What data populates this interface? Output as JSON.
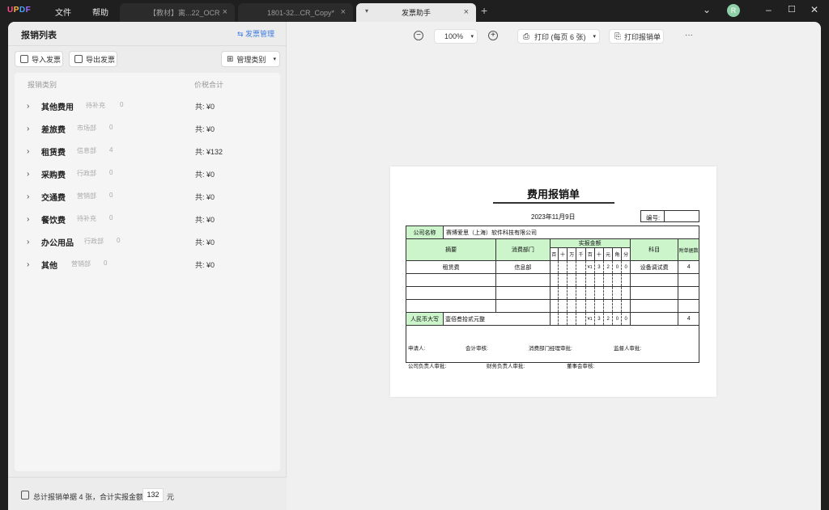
{
  "app": {
    "logo": "UPDF",
    "menu": [
      "文件",
      "帮助"
    ],
    "tabs": [
      {
        "label": "【教材】离...22_OCR"
      },
      {
        "label": "1801-32...CR_Copy*"
      },
      {
        "label": "发票助手"
      }
    ],
    "avatar": "R",
    "colors": {
      "accent": "#3d7be0",
      "table_header": "#ccf5cc"
    }
  },
  "left": {
    "title": "报销列表",
    "manage_link": "发票管理",
    "import_btn": "导入发票",
    "export_btn": "导出发票",
    "category_btn": "管理类别",
    "col_category": "报销类别",
    "col_total": "价税合计",
    "rows": [
      {
        "category": "其他费用",
        "dept": "待补充",
        "count": "0",
        "amount": "共: ¥0"
      },
      {
        "category": "差旅费",
        "dept": "市场部",
        "count": "0",
        "amount": "共: ¥0"
      },
      {
        "category": "租赁费",
        "dept": "信息部",
        "count": "4",
        "amount": "共: ¥132"
      },
      {
        "category": "采购费",
        "dept": "行政部",
        "count": "0",
        "amount": "共: ¥0"
      },
      {
        "category": "交通费",
        "dept": "营销部",
        "count": "0",
        "amount": "共: ¥0"
      },
      {
        "category": "餐饮费",
        "dept": "待补充",
        "count": "0",
        "amount": "共: ¥0"
      },
      {
        "category": "办公用品",
        "dept": "行政部",
        "count": "0",
        "amount": "共: ¥0"
      },
      {
        "category": "其他",
        "dept": "营销部",
        "count": "0",
        "amount": "共: ¥0"
      }
    ],
    "footer_text": "总计报销单据 4 张，合计实报金额:",
    "footer_amount": "132",
    "footer_unit": "元"
  },
  "toolbar": {
    "zoom": "100%",
    "print": "打印 (每页 6 张)",
    "print_report": "打印报销单",
    "more": "···"
  },
  "document": {
    "title": "费用报销单",
    "date": "2023年11月9日",
    "number_label": "编号:",
    "company_label": "公司名称",
    "company": "赛博爱思（上海）软件科技有限公司",
    "h_summary": "摘要",
    "h_dept": "消费部门",
    "h_amount": "实报金额",
    "h_subject": "科目",
    "h_attach": "附单据数",
    "digits": [
      "百",
      "十",
      "万",
      "千",
      "百",
      "十",
      "元",
      "角",
      "分"
    ],
    "row1": {
      "summary": "租赁费",
      "dept": "信息部",
      "digits": [
        "",
        "",
        "",
        "",
        "¥1",
        "3",
        "2",
        "0",
        "0"
      ],
      "subject": "设备调试费",
      "attach": "4"
    },
    "rmb_label": "人民币大写",
    "rmb_value": "壹佰叁拾贰元整",
    "rmb_digits": [
      "",
      "",
      "",
      "",
      "¥1",
      "3",
      "2",
      "0",
      "0"
    ],
    "rmb_attach": "4",
    "sig": {
      "applicant": "申请人:",
      "accountant": "会计审核:",
      "dept_manager": "消费部门经理审批:",
      "supervisor": "监督人审批:",
      "company_head": "公司负责人审批:",
      "finance_head": "财务负责人审批:",
      "board": "董事会审核:"
    }
  }
}
